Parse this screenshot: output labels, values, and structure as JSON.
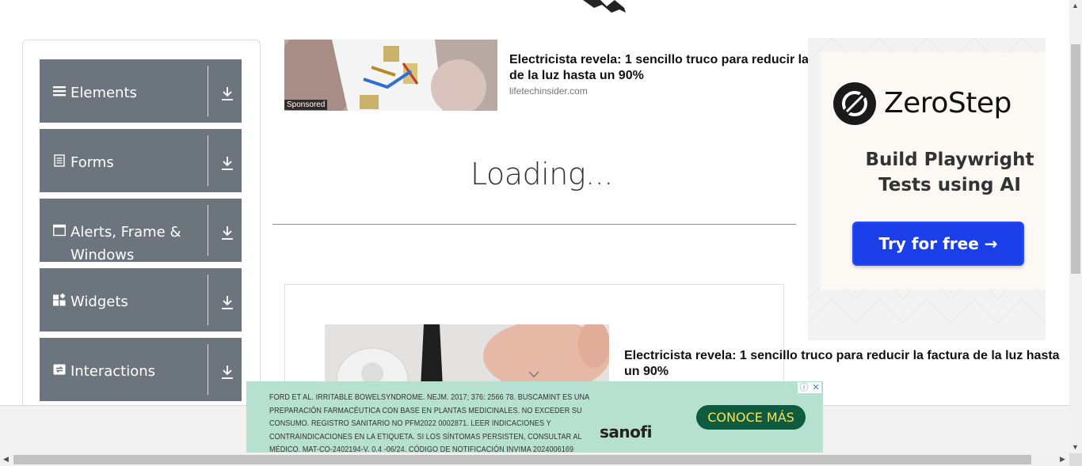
{
  "sidebar": {
    "groups": [
      {
        "label": "Elements",
        "icon": "menu-icon"
      },
      {
        "label": "Forms",
        "icon": "document-icon"
      },
      {
        "label": "Alerts, Frame & Windows",
        "icon": "window-icon"
      },
      {
        "label": "Widgets",
        "icon": "widgets-icon"
      },
      {
        "label": "Interactions",
        "icon": "interactions-icon"
      }
    ]
  },
  "ad_top": {
    "sponsored": "Sponsored",
    "title_line1": "Electricista revela: 1 sencillo truco para reducir la",
    "title_line2": "de la luz hasta un 90%",
    "domain": "lifetechinsider.com"
  },
  "main": {
    "loading": "Loading..."
  },
  "zerostep_ad": {
    "brand": "ZeroStep",
    "headline": "Build Playwright Tests using AI",
    "button": "Try for free →",
    "accent": "#1a3ee8"
  },
  "ad_second": {
    "title": "Electricista revela: 1 sencillo truco para reducir la factura de la luz hasta un 90%"
  },
  "sanofi_ad": {
    "disclaimer": "FORD ET AL. IRRITABLE BOWELSYNDROME. NEJM. 2017; 376: 2566 78. BUSCAMINT ES UNA PREPARACIÓN FARMACÉUTICA CON BASE EN PLANTAS MEDICINALES. NO EXCEDER SU CONSUMO. REGISTRO SANITARIO NO PFM2022 0002871. LEER INDICACIONES Y CONTRAINDICACIONES EN LA ETIQUETA. SI LOS SÍNTOMAS PERSISTEN, CONSULTAR AL MÉDICO. MAT-CO-2402194-V. 0.4 -06/24. CÓDIGO DE NOTIFICACIÓN INVIMA 2024006169",
    "button": "CONOCE MÁS",
    "logo": "sanofi",
    "background": "#b6e0cf"
  }
}
